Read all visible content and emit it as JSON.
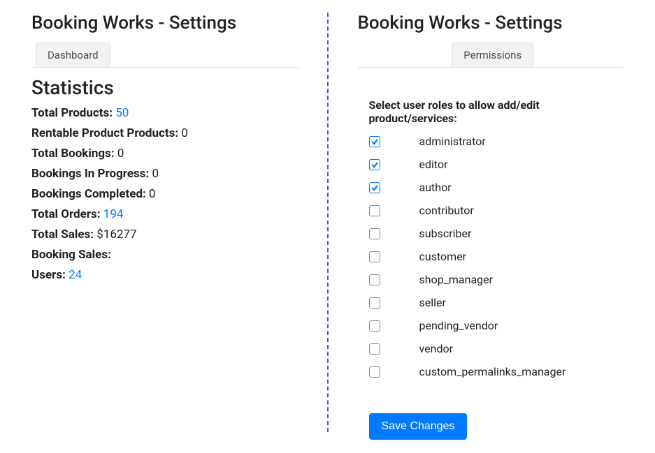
{
  "left": {
    "title": "Booking Works - Settings",
    "tab": "Dashboard",
    "stats_heading": "Statistics",
    "stats": [
      {
        "label": "Total Products:",
        "value": "50",
        "link": true
      },
      {
        "label": "Rentable Product Products:",
        "value": "0",
        "link": false
      },
      {
        "label": "Total Bookings:",
        "value": "0",
        "link": false
      },
      {
        "label": "Bookings In Progress:",
        "value": "0",
        "link": false
      },
      {
        "label": "Bookings Completed:",
        "value": "0",
        "link": false
      },
      {
        "label": "Total Orders:",
        "value": "194",
        "link": true
      },
      {
        "label": "Total Sales:",
        "value": "$16277",
        "link": false
      },
      {
        "label": "Booking Sales:",
        "value": "",
        "link": false
      },
      {
        "label": "Users:",
        "value": "24",
        "link": true
      }
    ]
  },
  "right": {
    "title": "Booking Works - Settings",
    "tab": "Permissions",
    "roles_heading": "Select user roles to allow add/edit product/services:",
    "roles": [
      {
        "name": "administrator",
        "checked": true
      },
      {
        "name": "editor",
        "checked": true
      },
      {
        "name": "author",
        "checked": true
      },
      {
        "name": "contributor",
        "checked": false
      },
      {
        "name": "subscriber",
        "checked": false
      },
      {
        "name": "customer",
        "checked": false
      },
      {
        "name": "shop_manager",
        "checked": false
      },
      {
        "name": "seller",
        "checked": false
      },
      {
        "name": "pending_vendor",
        "checked": false
      },
      {
        "name": "vendor",
        "checked": false
      },
      {
        "name": "custom_permalinks_manager",
        "checked": false
      }
    ],
    "save_label": "Save Changes"
  }
}
